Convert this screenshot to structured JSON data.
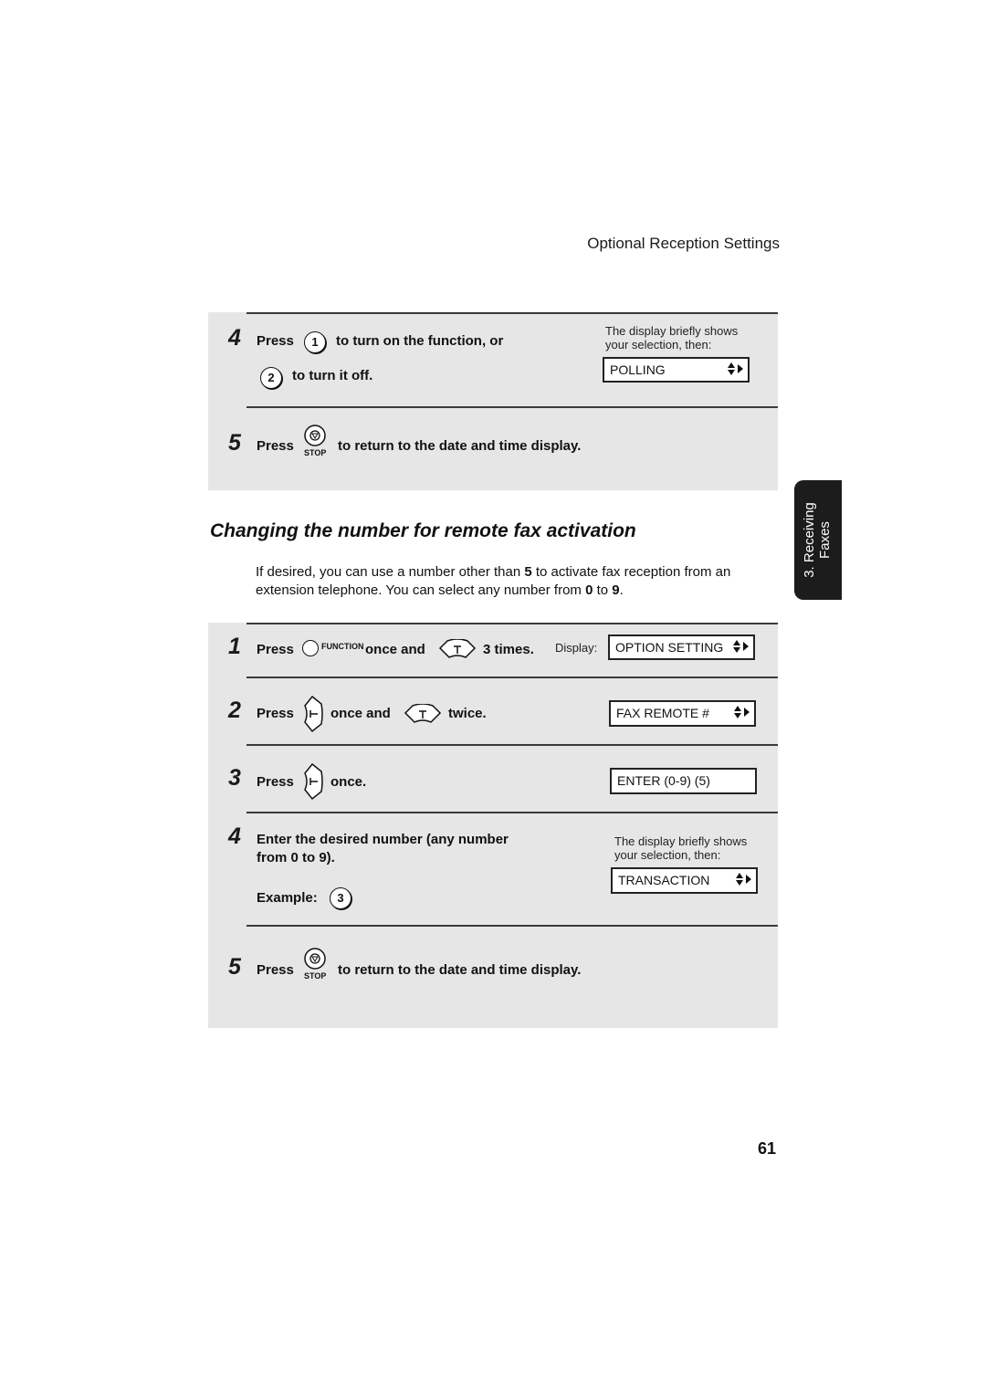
{
  "header": {
    "section_title": "Optional Reception Settings"
  },
  "side_tab": {
    "line1": "3. Receiving",
    "line2": "Faxes"
  },
  "page_number": "61",
  "top_panel": {
    "step4": {
      "number": "4",
      "press": "Press",
      "key1": "1",
      "text1": "to turn on the function, or",
      "key2": "2",
      "text2": "to turn it off.",
      "note_line1": "The display briefly shows",
      "note_line2": "your selection, then:",
      "display": "POLLING"
    },
    "step5": {
      "number": "5",
      "press": "Press",
      "key_label": "STOP",
      "text": "to return to the date and time display."
    }
  },
  "section": {
    "heading": "Changing the number for remote fax activation",
    "intro_parts": {
      "a": "If desired, you can use a number other than ",
      "b": "5",
      "c": " to activate fax reception from an",
      "d": "extension telephone. You can select any number from ",
      "e": "0",
      "f": " to ",
      "g": "9",
      "h": "."
    }
  },
  "steps": [
    {
      "number": "1",
      "press": "Press",
      "key_label": "FUNCTION",
      "mid": "once and",
      "end": "3 times.",
      "display_label": "Display:",
      "display": "OPTION SETTING"
    },
    {
      "number": "2",
      "press": "Press",
      "mid": "once and",
      "end": "twice.",
      "display": "FAX REMOTE #"
    },
    {
      "number": "3",
      "press": "Press",
      "end": "once.",
      "display": "ENTER (0-9) (5)"
    },
    {
      "number": "4",
      "line1": "Enter the desired number (any number",
      "line2": "from 0 to 9).",
      "example_label": "Example:",
      "example_key": "3",
      "note_line1": "The display briefly shows",
      "note_line2": "your selection, then:",
      "display": "TRANSACTION"
    },
    {
      "number": "5",
      "press": "Press",
      "key_label": "STOP",
      "text": "to return to the date and time display."
    }
  ]
}
